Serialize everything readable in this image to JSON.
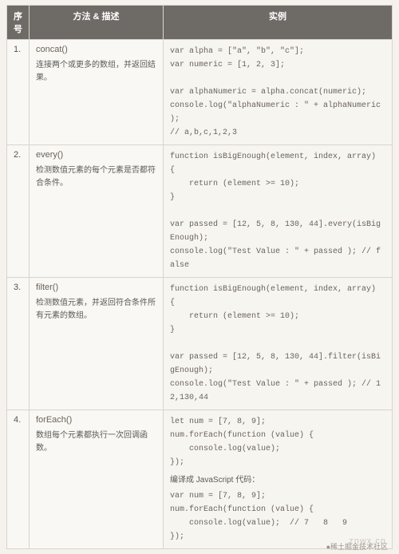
{
  "headers": {
    "idx": "序号",
    "desc": "方法 & 描述",
    "example": "实例"
  },
  "rows": [
    {
      "idx": "1.",
      "method": "concat()",
      "desc": "连接两个或更多的数组，并返回结果。",
      "code": "var alpha = [\"a\", \"b\", \"c\"];\nvar numeric = [1, 2, 3];\n\nvar alphaNumeric = alpha.concat(numeric);\nconsole.log(\"alphaNumeric : \" + alphaNumeric );\n// a,b,c,1,2,3"
    },
    {
      "idx": "2.",
      "method": "every()",
      "desc": "检测数值元素的每个元素是否都符合条件。",
      "code": "function isBigEnough(element, index, array) {\n    return (element >= 10);\n}\n\nvar passed = [12, 5, 8, 130, 44].every(isBigEnough);\nconsole.log(\"Test Value : \" + passed ); // false"
    },
    {
      "idx": "3.",
      "method": "filter()",
      "desc": "检测数值元素，并返回符合条件所有元素的数组。",
      "code": "function isBigEnough(element, index, array) {\n    return (element >= 10);\n}\n\nvar passed = [12, 5, 8, 130, 44].filter(isBigEnough);\nconsole.log(\"Test Value : \" + passed ); // 12,130,44"
    },
    {
      "idx": "4.",
      "method": "forEach()",
      "desc": "数组每个元素都执行一次回调函数。",
      "code1": "let num = [7, 8, 9];\nnum.forEach(function (value) {\n    console.log(value);\n});",
      "note": "编译成 JavaScript 代码：",
      "code2": "var num = [7, 8, 9];\nnum.forEach(function (value) {\n    console.log(value);  // 7   8   9\n});"
    }
  ],
  "watermark": "znwx.cn",
  "footer_credit": "●稀土掘金技术社区"
}
